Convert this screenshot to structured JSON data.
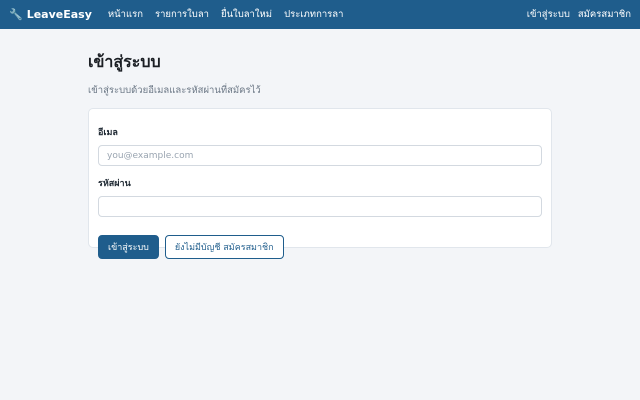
{
  "nav": {
    "brand": "LeaveEasy",
    "brand_icon": "wrench-icon",
    "links": [
      "หน้าแรก",
      "รายการใบลา",
      "ยื่นใบลาใหม่",
      "ประเภทการลา"
    ],
    "login": "เข้าสู่ระบบ",
    "register": "สมัครสมาชิก"
  },
  "page": {
    "title": "เข้าสู่ระบบ",
    "subtitle": "เข้าสู่ระบบด้วยอีเมลและรหัสผ่านที่สมัครไว้"
  },
  "form": {
    "email_label": "อีเมล",
    "email_placeholder": "you@example.com",
    "email_value": "",
    "password_label": "รหัสผ่าน",
    "password_value": "",
    "submit_label": "เข้าสู่ระบบ",
    "register_label": "ยังไม่มีบัญชี สมัครสมาชิก"
  },
  "colors": {
    "navbar": "#1f5d8c",
    "primary": "#1f5d8c",
    "background": "#f3f5f8"
  }
}
